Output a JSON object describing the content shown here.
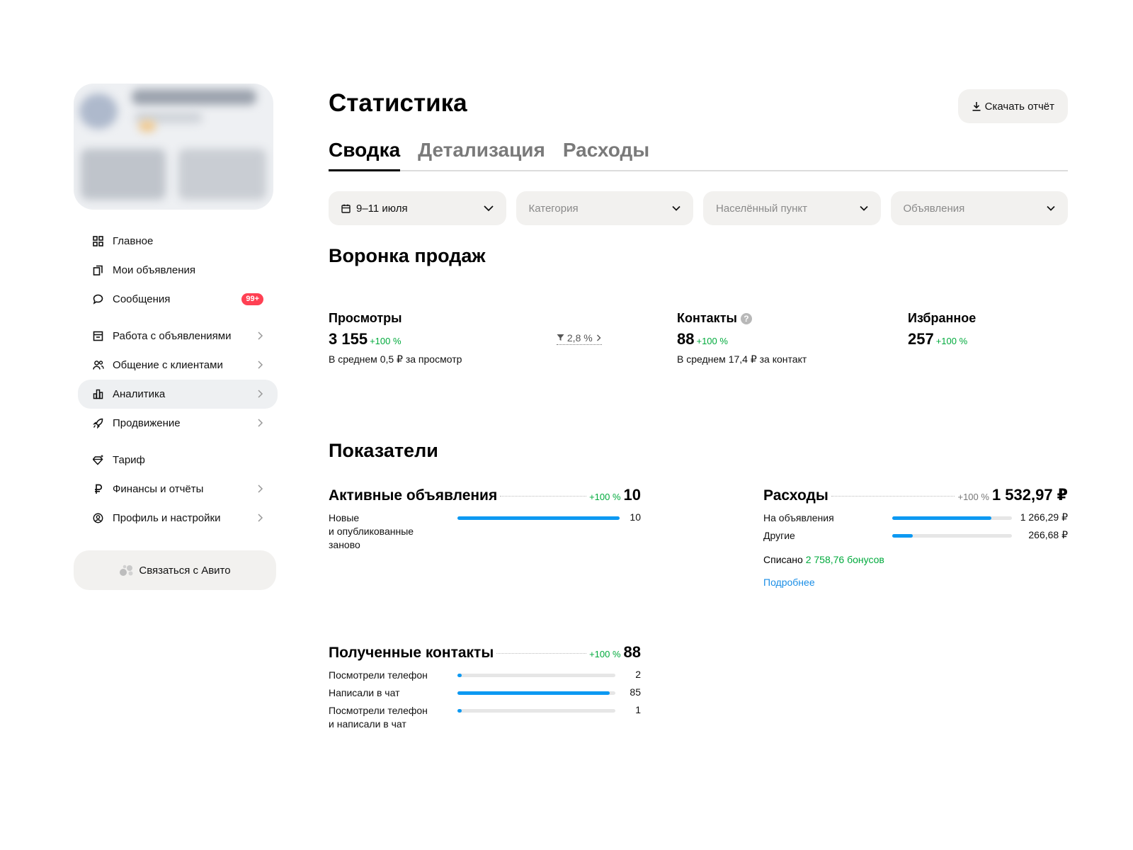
{
  "sidebar": {
    "nav": [
      {
        "label": "Главное",
        "icon": "grid-icon"
      },
      {
        "label": "Мои объявления",
        "icon": "copy-icon"
      },
      {
        "label": "Сообщения",
        "icon": "chat-icon",
        "badge": "99+"
      },
      {
        "label": "Работа с объявлениями",
        "icon": "listing-work-icon"
      },
      {
        "label": "Общение с клиентами",
        "icon": "clients-icon"
      },
      {
        "label": "Аналитика",
        "icon": "bar-chart-icon",
        "active": true
      },
      {
        "label": "Продвижение",
        "icon": "rocket-icon"
      },
      {
        "label": "Тариф",
        "icon": "diamond-icon"
      },
      {
        "label": "Финансы и отчёты",
        "icon": "ruble-icon"
      },
      {
        "label": "Профиль и настройки",
        "icon": "user-circle-icon"
      }
    ],
    "contact_button": "Связаться с Авито"
  },
  "main": {
    "title": "Статистика",
    "download_button": "Скачать отчёт",
    "tabs": [
      "Сводка",
      "Детализация",
      "Расходы"
    ],
    "filters": {
      "date": "9–11 июля",
      "category": "Категория",
      "locality": "Населённый пункт",
      "ads": "Объявления"
    }
  },
  "funnel": {
    "title": "Воронка продаж",
    "views": {
      "label": "Просмотры",
      "value": "3 155",
      "delta": "+100 %",
      "note": "В среднем 0,5 ₽ за просмотр",
      "conversion": "2,8 %"
    },
    "contacts": {
      "label": "Контакты",
      "value": "88",
      "delta": "+100 %",
      "note": "В среднем 17,4 ₽ за контакт"
    },
    "favorites": {
      "label": "Избранное",
      "value": "257",
      "delta": "+100 %"
    }
  },
  "indicators": {
    "title": "Показатели",
    "active_ads": {
      "title": "Активные объявления",
      "delta": "+100 %",
      "value": "10",
      "rows": [
        {
          "label": "Новые\nи опубликованные\nзаново",
          "value": "10",
          "fraction": 1.0
        }
      ]
    },
    "expenses": {
      "title": "Расходы",
      "delta": "+100 %",
      "value": "1 532,97 ₽",
      "rows": [
        {
          "label": "На объявления",
          "value": "1 266,29 ₽",
          "fraction": 0.826
        },
        {
          "label": "Другие",
          "value": "266,68 ₽",
          "fraction": 0.174
        }
      ],
      "spent_label": "Списано",
      "spent_bonus": "2 758,76 бонусов",
      "more_link": "Подробнее"
    },
    "contacts": {
      "title": "Полученные контакты",
      "delta": "+100 %",
      "value": "88",
      "rows": [
        {
          "label": "Посмотрели телефон",
          "value": "2",
          "fraction": 0.023
        },
        {
          "label": "Написали в чат",
          "value": "85",
          "fraction": 0.966
        },
        {
          "label": "Посмотрели телефон\nи написали в чат",
          "value": "1",
          "fraction": 0.011
        }
      ]
    }
  },
  "colors": {
    "accent": "#0d99f2",
    "positive": "#00aa3c",
    "badge": "#ff4053",
    "link": "#1a8ee6"
  }
}
